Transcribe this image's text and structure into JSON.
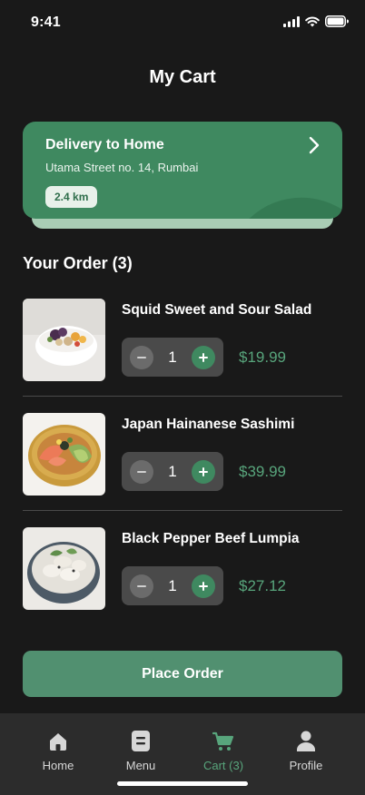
{
  "status": {
    "time": "9:41"
  },
  "title": "My Cart",
  "delivery": {
    "title": "Delivery to Home",
    "address": "Utama Street no. 14, Rumbai",
    "distance": "2.4 km"
  },
  "order_section": {
    "title": "Your Order (3)"
  },
  "items": [
    {
      "name": "Squid Sweet and Sour Salad",
      "quantity": "1",
      "price": "$19.99"
    },
    {
      "name": "Japan Hainanese Sashimi",
      "quantity": "1",
      "price": "$39.99"
    },
    {
      "name": "Black Pepper Beef Lumpia",
      "quantity": "1",
      "price": "$27.12"
    }
  ],
  "place_order_label": "Place Order",
  "tabs": [
    {
      "label": "Home",
      "icon": "home-icon"
    },
    {
      "label": "Menu",
      "icon": "menu-icon"
    },
    {
      "label": "Cart (3)",
      "icon": "cart-icon",
      "active": true
    },
    {
      "label": "Profile",
      "icon": "profile-icon"
    }
  ],
  "colors": {
    "background": "#191919",
    "accent": "#3f8960",
    "price": "#58a57c",
    "tab_bar": "#2c2c2c"
  }
}
